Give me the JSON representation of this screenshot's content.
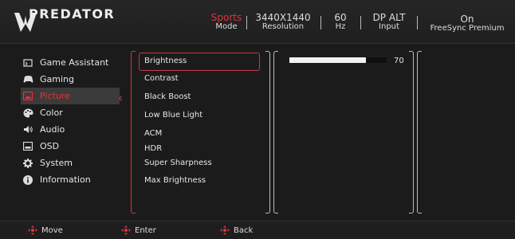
{
  "header": {
    "brand": "PREDATOR",
    "stats": [
      {
        "value": "Sports",
        "label": "Mode"
      },
      {
        "value": "3440X1440",
        "label": "Resolution"
      },
      {
        "value": "60",
        "label": "Hz"
      },
      {
        "value": "DP ALT",
        "label": "Input"
      },
      {
        "value": "On",
        "label": "FreeSync Premium"
      }
    ],
    "accent": "#e0343a"
  },
  "sidebar": {
    "items": [
      {
        "label": "Game Assistant",
        "icon": "game-assistant-icon"
      },
      {
        "label": "Gaming",
        "icon": "gamepad-icon"
      },
      {
        "label": "Picture",
        "icon": "picture-icon"
      },
      {
        "label": "Color",
        "icon": "palette-icon"
      },
      {
        "label": "Audio",
        "icon": "speaker-icon"
      },
      {
        "label": "OSD",
        "icon": "osd-icon"
      },
      {
        "label": "System",
        "icon": "gear-icon"
      },
      {
        "label": "Information",
        "icon": "info-icon"
      }
    ],
    "active_index": 2
  },
  "submenu": {
    "items": [
      "Brightness",
      "Contrast",
      "Black Boost",
      "Low Blue Light",
      "ACM",
      "HDR",
      "Super Sharpness",
      "Max Brightness"
    ],
    "selected_index": 0
  },
  "value_panel": {
    "value": "70",
    "fill_fraction": 0.79
  },
  "footer": {
    "items": [
      {
        "label": "Move"
      },
      {
        "label": "Enter"
      },
      {
        "label": "Back"
      }
    ]
  }
}
